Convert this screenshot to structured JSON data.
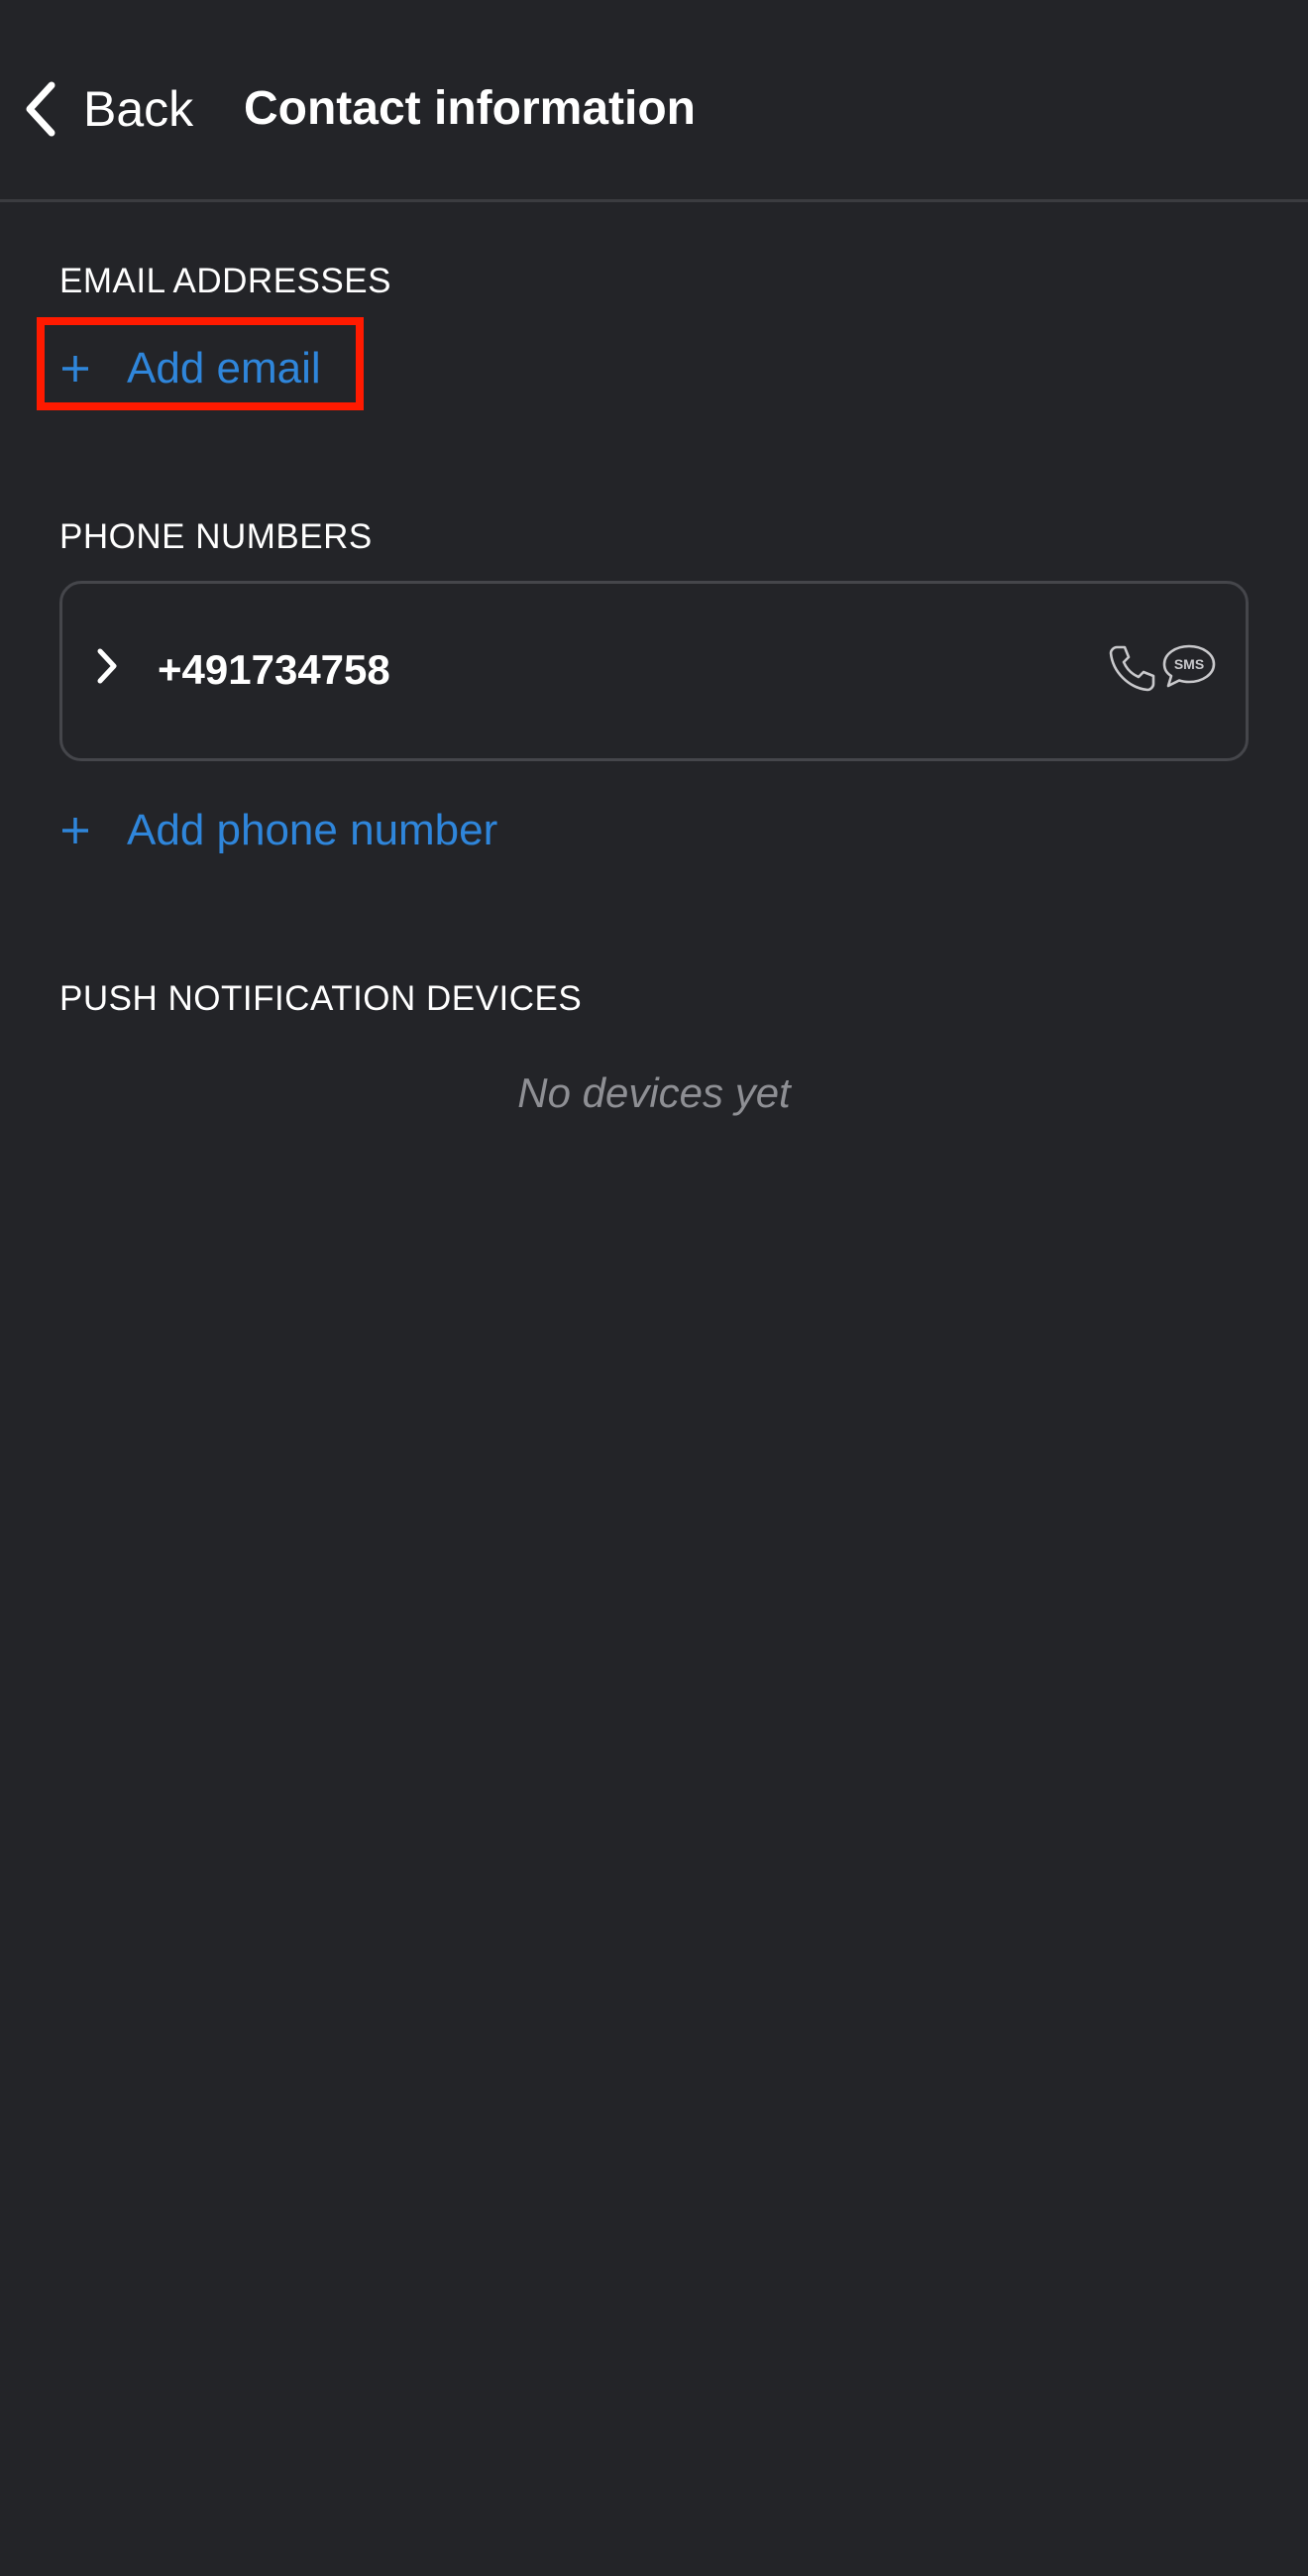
{
  "header": {
    "back_label": "Back",
    "title": "Contact information"
  },
  "email_section": {
    "label": "EMAIL ADDRESSES",
    "add_label": "Add email"
  },
  "phone_section": {
    "label": "PHONE NUMBERS",
    "numbers": [
      {
        "value": "+491734758",
        "channel_icons": [
          "phone-call-icon",
          "sms-icon"
        ],
        "sms_badge_text": "SMS"
      }
    ],
    "add_label": "Add phone number"
  },
  "push_section": {
    "label": "PUSH NOTIFICATION DEVICES",
    "empty_text": "No devices yet"
  },
  "colors": {
    "background": "#232428",
    "accent": "#2f86db",
    "highlight": "#ff1a00",
    "muted_text": "#8e8f94",
    "divider": "#3b3c40"
  }
}
